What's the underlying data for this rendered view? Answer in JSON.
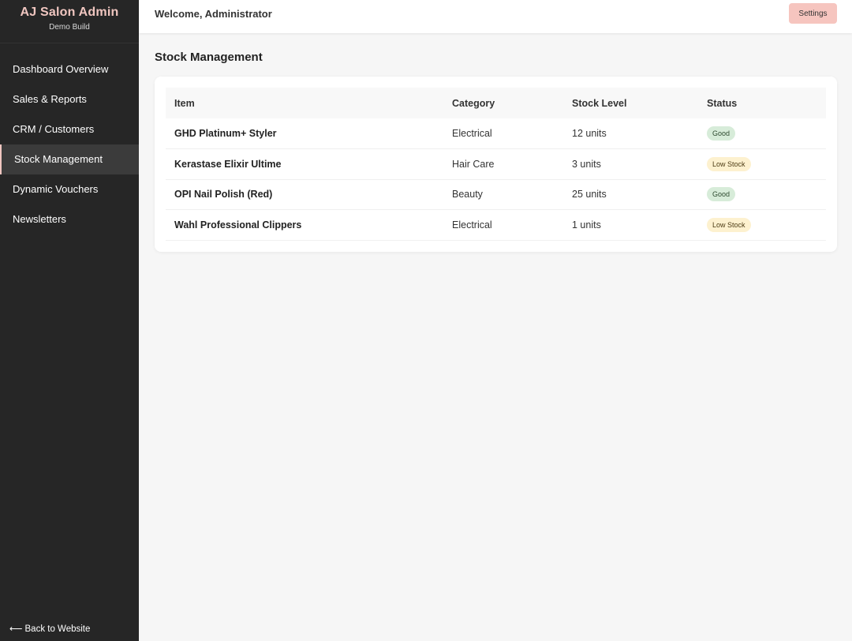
{
  "sidebar": {
    "brand_title": "AJ Salon Admin",
    "brand_subtitle": "Demo Build",
    "items": [
      {
        "label": "Dashboard Overview",
        "active": false
      },
      {
        "label": "Sales & Reports",
        "active": false
      },
      {
        "label": "CRM / Customers",
        "active": false
      },
      {
        "label": "Stock Management",
        "active": true
      },
      {
        "label": "Dynamic Vouchers",
        "active": false
      },
      {
        "label": "Newsletters",
        "active": false
      }
    ],
    "back_label": "Back to Website",
    "back_icon": "arrow-left-icon"
  },
  "header": {
    "welcome": "Welcome, Administrator",
    "settings_label": "Settings"
  },
  "main": {
    "title": "Stock Management",
    "table": {
      "columns": [
        "Item",
        "Category",
        "Stock Level",
        "Status"
      ],
      "rows": [
        {
          "item": "GHD Platinum+ Styler",
          "category": "Electrical",
          "stock": "12 units",
          "status": "Good",
          "status_type": "good"
        },
        {
          "item": "Kerastase Elixir Ultime",
          "category": "Hair Care",
          "stock": "3 units",
          "status": "Low Stock",
          "status_type": "low"
        },
        {
          "item": "OPI Nail Polish (Red)",
          "category": "Beauty",
          "stock": "25 units",
          "status": "Good",
          "status_type": "good"
        },
        {
          "item": "Wahl Professional Clippers",
          "category": "Electrical",
          "stock": "1 units",
          "status": "Low Stock",
          "status_type": "low"
        }
      ]
    }
  },
  "colors": {
    "sidebar_bg": "#262626",
    "brand_accent": "#f0c6c0",
    "settings_bg": "#f6c5bf",
    "badge_good_bg": "#d7ecd9",
    "badge_low_bg": "#fdf1cf"
  }
}
